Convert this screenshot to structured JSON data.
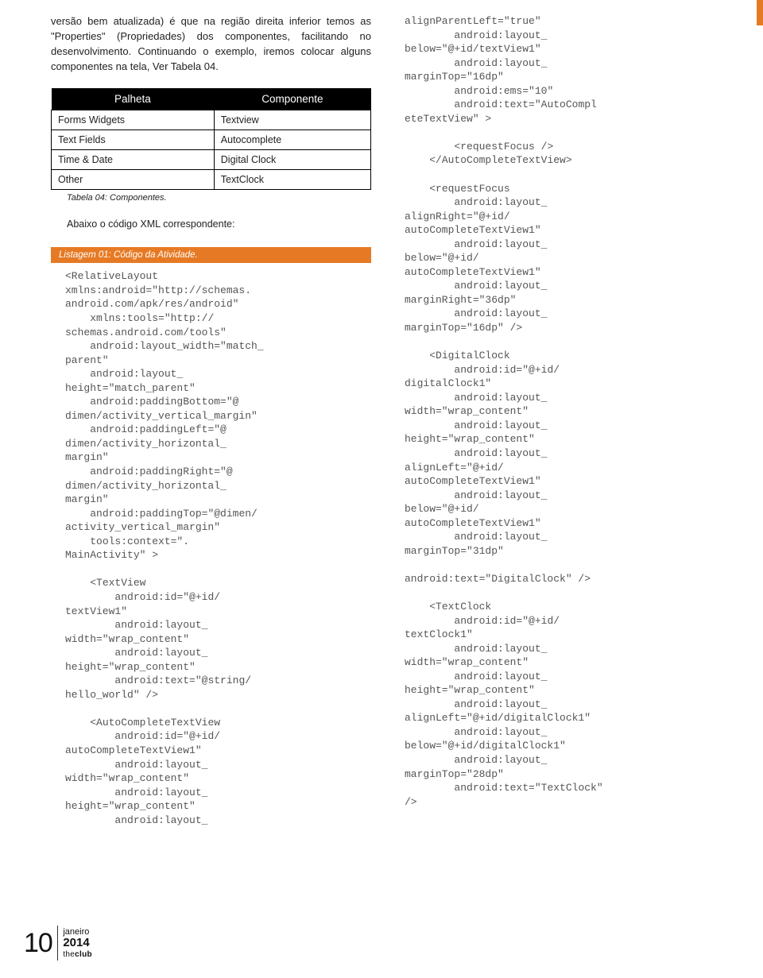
{
  "intro": "versão bem atualizada) é que na região direita inferior temos as \"Properties\" (Propriedades) dos componentes, facilitando no desenvolvimento. Continuando o exemplo, iremos colocar alguns componentes na tela, Ver Tabela 04.",
  "table": {
    "head_left": "Palheta",
    "head_right": "Componente",
    "rows": [
      {
        "left": "Forms Widgets",
        "right": "Textview"
      },
      {
        "left": "Text Fields",
        "right": "Autocomplete"
      },
      {
        "left": "Time & Date",
        "right": "Digital Clock"
      },
      {
        "left": "Other",
        "right": "TextClock"
      }
    ],
    "caption": "Tabela 04: Componentes."
  },
  "xml_lead": "Abaixo o código XML correspondente:",
  "listing_label": "Listagem 01: Código da Atividade.",
  "code_left": "<RelativeLayout\nxmlns:android=\"http://schemas.\nandroid.com/apk/res/android\"\n    xmlns:tools=\"http://\nschemas.android.com/tools\"\n    android:layout_width=\"match_\nparent\"\n    android:layout_\nheight=\"match_parent\"\n    android:paddingBottom=\"@\ndimen/activity_vertical_margin\"\n    android:paddingLeft=\"@\ndimen/activity_horizontal_\nmargin\"\n    android:paddingRight=\"@\ndimen/activity_horizontal_\nmargin\"\n    android:paddingTop=\"@dimen/\nactivity_vertical_margin\"\n    tools:context=\".\nMainActivity\" >\n\n    <TextView\n        android:id=\"@+id/\ntextView1\"\n        android:layout_\nwidth=\"wrap_content\"\n        android:layout_\nheight=\"wrap_content\"\n        android:text=\"@string/\nhello_world\" />\n\n    <AutoCompleteTextView\n        android:id=\"@+id/\nautoCompleteTextView1\"\n        android:layout_\nwidth=\"wrap_content\"\n        android:layout_\nheight=\"wrap_content\"\n        android:layout_",
  "code_right": "alignParentLeft=\"true\"\n        android:layout_\nbelow=\"@+id/textView1\"\n        android:layout_\nmarginTop=\"16dp\"\n        android:ems=\"10\"\n        android:text=\"AutoCompl\neteTextView\" >\n\n        <requestFocus />\n    </AutoCompleteTextView>\n\n    <requestFocus\n        android:layout_\nalignRight=\"@+id/\nautoCompleteTextView1\"\n        android:layout_\nbelow=\"@+id/\nautoCompleteTextView1\"\n        android:layout_\nmarginRight=\"36dp\"\n        android:layout_\nmarginTop=\"16dp\" />\n\n    <DigitalClock\n        android:id=\"@+id/\ndigitalClock1\"\n        android:layout_\nwidth=\"wrap_content\"\n        android:layout_\nheight=\"wrap_content\"\n        android:layout_\nalignLeft=\"@+id/\nautoCompleteTextView1\"\n        android:layout_\nbelow=\"@+id/\nautoCompleteTextView1\"\n        android:layout_\nmarginTop=\"31dp\"\n        \nandroid:text=\"DigitalClock\" />\n\n    <TextClock\n        android:id=\"@+id/\ntextClock1\"\n        android:layout_\nwidth=\"wrap_content\"\n        android:layout_\nheight=\"wrap_content\"\n        android:layout_\nalignLeft=\"@+id/digitalClock1\"\n        android:layout_\nbelow=\"@+id/digitalClock1\"\n        android:layout_\nmarginTop=\"28dp\"\n        android:text=\"TextClock\" \n/>",
  "footer": {
    "page_number": "10",
    "month": "janeiro",
    "year": "2014",
    "brand_prefix": "the",
    "brand_suffix": "club"
  }
}
